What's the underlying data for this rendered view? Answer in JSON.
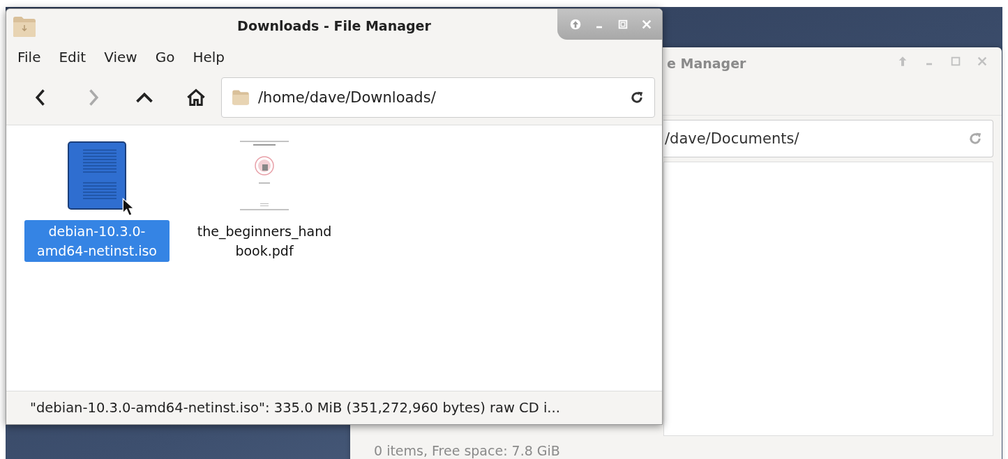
{
  "back_window": {
    "title": "e Manager",
    "path": "/dave/Documents/",
    "status_bar": "0 items, Free space: 7.8 GiB"
  },
  "window": {
    "title": "Downloads - File Manager"
  },
  "menu": [
    "File",
    "Edit",
    "View",
    "Go",
    "Help"
  ],
  "toolbar": {
    "back_disabled": false,
    "forward_disabled": true
  },
  "path": "/home/dave/Downloads/",
  "files": [
    {
      "kind": "iso",
      "name": "debian-10.3.0-amd64-netinst.iso",
      "selected": true
    },
    {
      "kind": "pdf",
      "name": "the_beginners_handbook.pdf",
      "selected": false
    }
  ],
  "status_bar": "\"debian-10.3.0-amd64-netinst.iso\": 335.0 MiB (351,272,960 bytes) raw CD i..."
}
